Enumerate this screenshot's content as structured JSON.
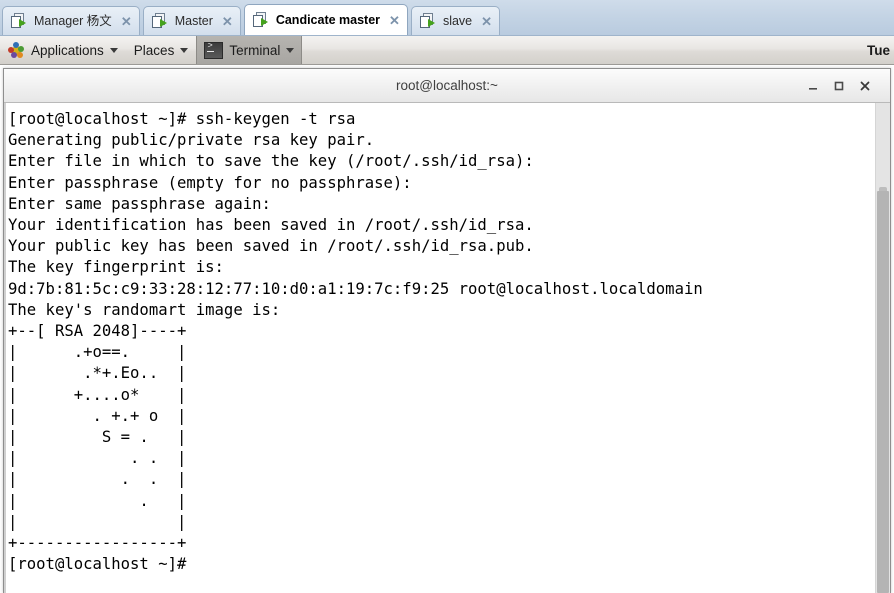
{
  "browser_tabs": {
    "tabs": [
      {
        "label": "Manager 杨文",
        "icon": "window-play-icon",
        "close": "✕",
        "active": false
      },
      {
        "label": "Master",
        "icon": "window-play-icon",
        "close": "✕",
        "active": false
      },
      {
        "label": "Candicate master",
        "icon": "window-play-icon",
        "close": "✕",
        "active": true
      },
      {
        "label": "slave",
        "icon": "window-play-icon",
        "close": "✕",
        "active": false
      }
    ]
  },
  "panel": {
    "applications_label": "Applications",
    "places_label": "Places",
    "window_label": "Terminal",
    "clock": "Tue "
  },
  "window": {
    "title": "root@localhost:~",
    "minimize_label": "minimize",
    "maximize_label": "maximize",
    "close_label": "close"
  },
  "terminal": {
    "lines": [
      "[root@localhost ~]# ssh-keygen -t rsa",
      "Generating public/private rsa key pair.",
      "Enter file in which to save the key (/root/.ssh/id_rsa): ",
      "Enter passphrase (empty for no passphrase): ",
      "Enter same passphrase again: ",
      "Your identification has been saved in /root/.ssh/id_rsa.",
      "Your public key has been saved in /root/.ssh/id_rsa.pub.",
      "The key fingerprint is:",
      "9d:7b:81:5c:c9:33:28:12:77:10:d0:a1:19:7c:f9:25 root@localhost.localdomain",
      "The key's randomart image is:",
      "+--[ RSA 2048]----+",
      "|      .+o==.     |",
      "|       .*+.Eo..  |",
      "|      +....o*    |",
      "|        . +.+ o  |",
      "|         S = .   |",
      "|            . .  |",
      "|           .  .  |",
      "|             .   |",
      "|                 |",
      "+-----------------+",
      "[root@localhost ~]# "
    ]
  }
}
